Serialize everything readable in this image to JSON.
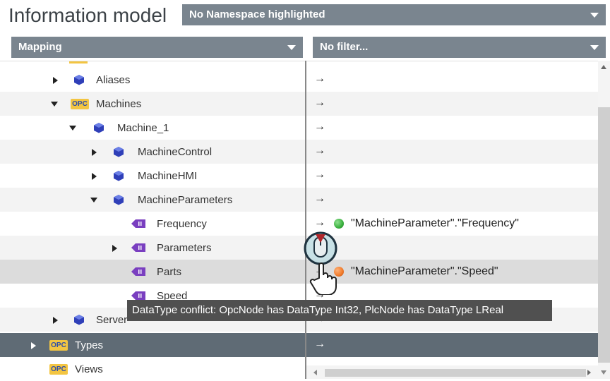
{
  "header": {
    "title": "Information model",
    "namespace_select": "No Namespace highlighted"
  },
  "toolbar": {
    "mapping_select": "Mapping",
    "filter_select": "No filter..."
  },
  "tree": [
    {
      "label": "Aliases",
      "icon": "object-cube-icon",
      "expander": "collapsed",
      "mapping_arrow": "→"
    },
    {
      "label": "Machines",
      "icon": "opc-folder-icon",
      "expander": "expanded",
      "mapping_arrow": "→"
    },
    {
      "label": "Machine_1",
      "icon": "object-cube-icon",
      "expander": "expanded",
      "mapping_arrow": "→"
    },
    {
      "label": "MachineControl",
      "icon": "object-cube-icon",
      "expander": "collapsed",
      "mapping_arrow": "→"
    },
    {
      "label": "MachineHMI",
      "icon": "object-cube-icon",
      "expander": "collapsed",
      "mapping_arrow": "→"
    },
    {
      "label": "MachineParameters",
      "icon": "object-cube-icon",
      "expander": "expanded",
      "mapping_arrow": "→"
    },
    {
      "label": "Frequency",
      "icon": "variable-icon",
      "expander": "none",
      "mapping_arrow": "→",
      "status": "green",
      "plc_tag": "\"MachineParameter\".\"Frequency\""
    },
    {
      "label": "Parameters",
      "icon": "variable-icon",
      "expander": "collapsed",
      "mapping_arrow": ""
    },
    {
      "label": "Parts",
      "icon": "variable-icon",
      "expander": "none",
      "mapping_arrow": "→",
      "status": "orange",
      "plc_tag": "\"MachineParameter\".\"Speed\""
    },
    {
      "label": "Speed",
      "icon": "variable-icon",
      "expander": "none",
      "mapping_arrow": "→"
    },
    {
      "label": "Server",
      "icon": "object-cube-icon",
      "expander": "collapsed",
      "mapping_arrow": "→"
    },
    {
      "label": "Types",
      "icon": "opc-folder-icon",
      "expander": "collapsed",
      "mapping_arrow": "→"
    },
    {
      "label": "Views",
      "icon": "opc-folder-icon",
      "expander": "none",
      "mapping_arrow": ""
    }
  ],
  "icons": {
    "opc_badge": "OPC"
  },
  "tooltip": "DataType conflict: OpcNode has DataType Int32, PlcNode has DataType LReal",
  "colors": {
    "header_select_bg": "#7a858f",
    "selected_row_bg": "#dcdcdc",
    "dark_row_bg": "#5f6b75",
    "status_ok": "#3ab03e",
    "status_conflict": "#f07a2a",
    "object_icon": "#2f3fb8",
    "variable_icon": "#7a3fc0",
    "opc_badge": "#f3c542"
  }
}
